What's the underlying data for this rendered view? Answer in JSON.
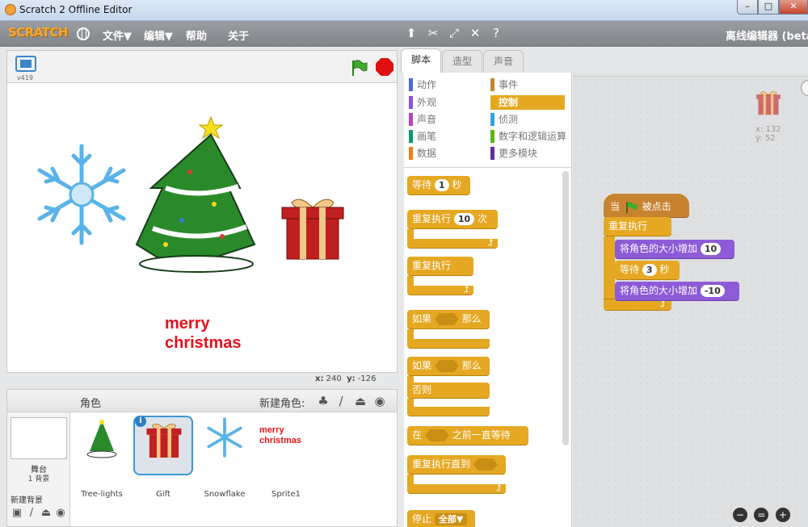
{
  "window": {
    "title": "Scratch 2 Offline Editor",
    "min": "–",
    "max": "□",
    "close": "✕"
  },
  "menubar": {
    "logo": "SCRATCH",
    "items": [
      "文件▼",
      "编辑▼",
      "帮助",
      "关于"
    ],
    "tools": [
      "duplicate-icon",
      "cut-icon",
      "grow-icon",
      "shrink-icon",
      "help-icon"
    ],
    "edition": "离线编辑器 (beta"
  },
  "stage": {
    "version": "v419",
    "text_line1": "merry",
    "text_line2": "christmas",
    "coords_x_label": "x:",
    "coords_x": "240",
    "coords_y_label": "y:",
    "coords_y": "-126"
  },
  "sprites": {
    "header": "角色",
    "new_sprite": "新建角色:",
    "stage_label": "舞台",
    "backdrop_count": "1 背景",
    "new_backdrop": "新建背景",
    "items": [
      {
        "name": "Tree-lights"
      },
      {
        "name": "Gift"
      },
      {
        "name": "Snowflake"
      },
      {
        "name": "Sprite1"
      }
    ],
    "sprite1_line1": "merry",
    "sprite1_line2": "christmas"
  },
  "tabs": [
    "脚本",
    "造型",
    "声音"
  ],
  "categories": {
    "left": [
      {
        "label": "动作",
        "color": "#4a6cd4"
      },
      {
        "label": "外观",
        "color": "#8a55d7"
      },
      {
        "label": "声音",
        "color": "#bb42c3"
      },
      {
        "label": "画笔",
        "color": "#0e9a6c"
      },
      {
        "label": "数据",
        "color": "#ee7d16"
      }
    ],
    "right": [
      {
        "label": "事件",
        "color": "#c88330"
      },
      {
        "label": "控制",
        "color": "#e1a91a"
      },
      {
        "label": "侦测",
        "color": "#2ca5e2"
      },
      {
        "label": "数字和逻辑运算",
        "color": "#5cb712"
      },
      {
        "label": "更多模块",
        "color": "#632d99"
      }
    ]
  },
  "palette": {
    "wait": "等待",
    "wait_val": "1",
    "wait_unit": "秒",
    "repeat": "重复执行",
    "repeat_val": "10",
    "repeat_unit": "次",
    "forever": "重复执行",
    "if": "如果",
    "then": "那么",
    "if2": "如果",
    "then2": "那么",
    "else": "否则",
    "wait_until_pre": "在",
    "wait_until_post": "之前一直等待",
    "repeat_until": "重复执行直到",
    "stop": "停止",
    "stop_val": "全部▼"
  },
  "script": {
    "hat_pre": "当",
    "hat_post": "被点击",
    "forever": "重复执行",
    "change_size": "将角色的大小增加",
    "change_val1": "10",
    "wait": "等待",
    "wait_val": "3",
    "wait_unit": "秒",
    "change_size2": "将角色的大小增加",
    "change_val2": "-10",
    "sprite_x_label": "x:",
    "sprite_x": "132",
    "sprite_y_label": "y:",
    "sprite_y": "52"
  },
  "zoom": [
    "−",
    "=",
    "+"
  ]
}
